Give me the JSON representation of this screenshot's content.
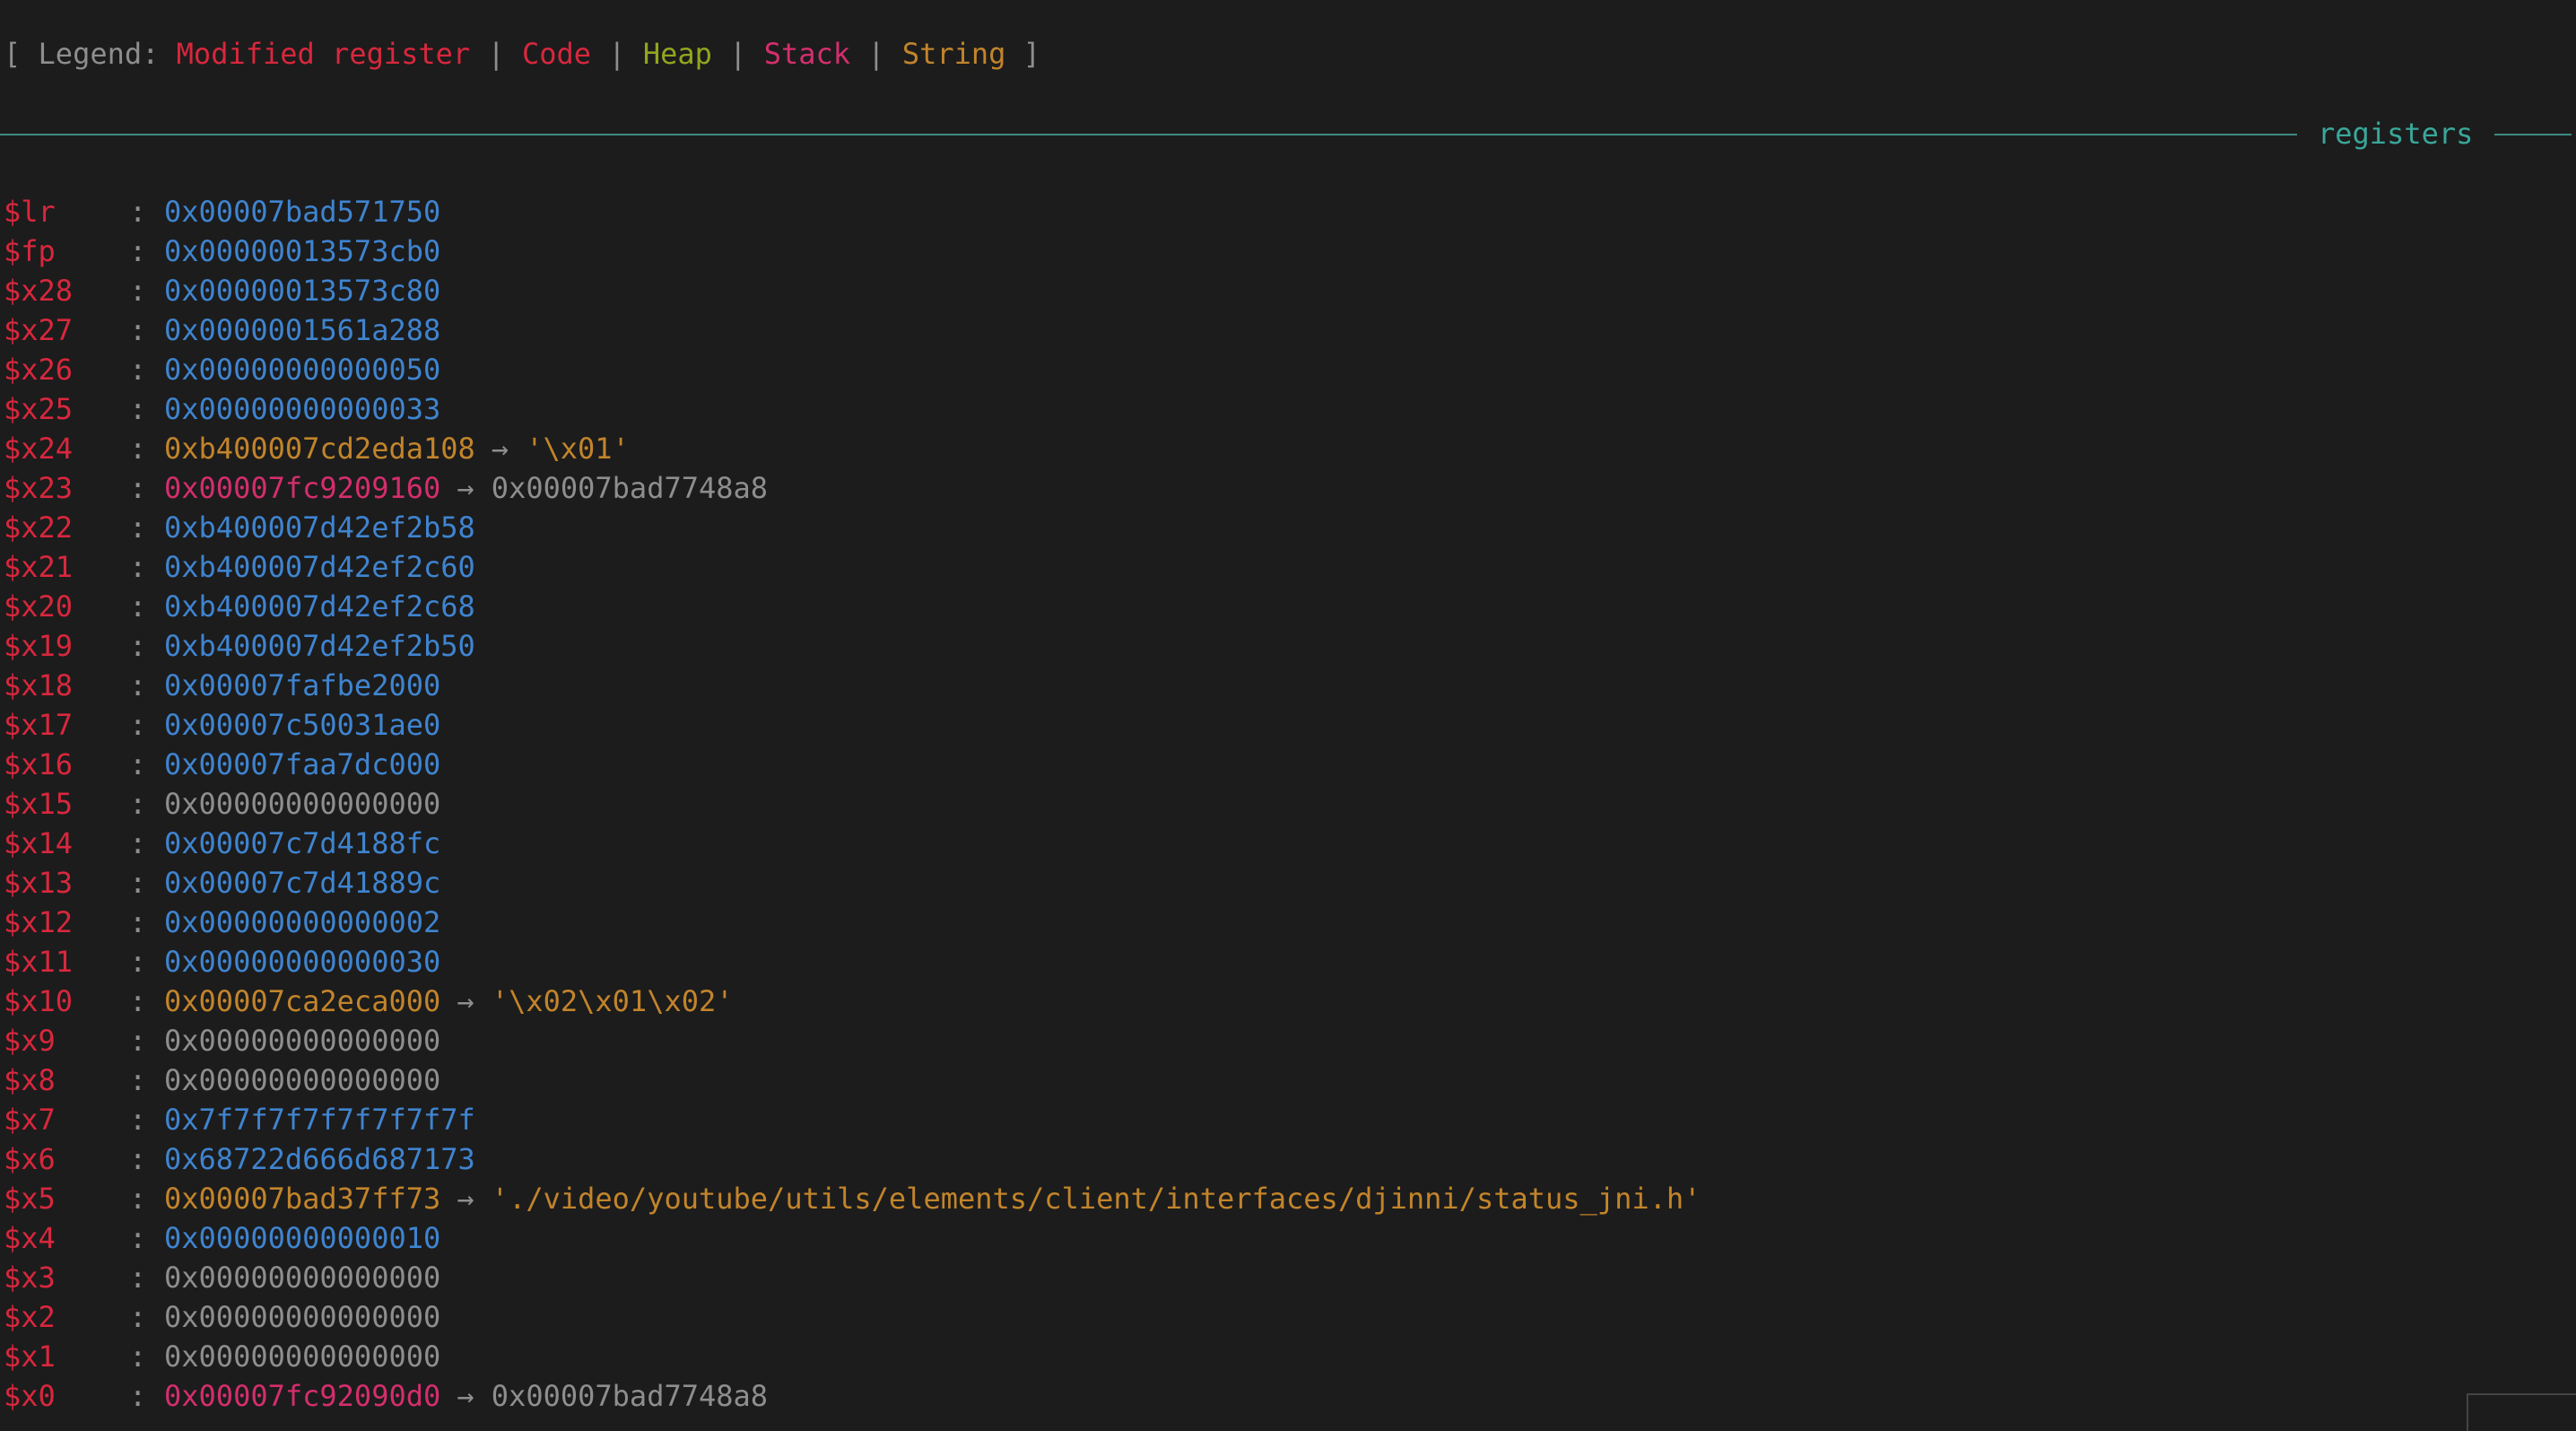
{
  "legend": {
    "open": "[ Legend: ",
    "modified": "Modified register",
    "sep1": " | ",
    "code": "Code",
    "sep2": " | ",
    "heap": "Heap",
    "sep3": " | ",
    "stack": "Stack",
    "sep4": " | ",
    "string": "String",
    "close": " ]"
  },
  "section": {
    "title": "registers"
  },
  "colors": {
    "modified": "#d8273d",
    "code": "#d8273d",
    "heap": "#93a51f",
    "stack": "#d42e6d",
    "string": "#c2842b",
    "pointer": "#3f84d0",
    "plain": "#8e8e8e",
    "accent": "#3aa79a"
  },
  "colon": ":",
  "arrow": "→",
  "registers": [
    {
      "name": "$lr",
      "value": "0x00007bad571750",
      "kind": "pointer"
    },
    {
      "name": "$fp",
      "value": "0x00000013573cb0",
      "kind": "pointer"
    },
    {
      "name": "$x28",
      "value": "0x00000013573c80",
      "kind": "pointer"
    },
    {
      "name": "$x27",
      "value": "0x0000001561a288",
      "kind": "pointer"
    },
    {
      "name": "$x26",
      "value": "0x00000000000050",
      "kind": "pointer"
    },
    {
      "name": "$x25",
      "value": "0x00000000000033",
      "kind": "pointer"
    },
    {
      "name": "$x24",
      "value": "0xb400007cd2eda108",
      "kind": "string",
      "deref": "'\\x01'",
      "deref_kind": "string"
    },
    {
      "name": "$x23",
      "value": "0x00007fc9209160",
      "kind": "stack",
      "deref": "0x00007bad7748a8",
      "deref_kind": "plain"
    },
    {
      "name": "$x22",
      "value": "0xb400007d42ef2b58",
      "kind": "pointer"
    },
    {
      "name": "$x21",
      "value": "0xb400007d42ef2c60",
      "kind": "pointer"
    },
    {
      "name": "$x20",
      "value": "0xb400007d42ef2c68",
      "kind": "pointer"
    },
    {
      "name": "$x19",
      "value": "0xb400007d42ef2b50",
      "kind": "pointer"
    },
    {
      "name": "$x18",
      "value": "0x00007fafbe2000",
      "kind": "pointer"
    },
    {
      "name": "$x17",
      "value": "0x00007c50031ae0",
      "kind": "pointer"
    },
    {
      "name": "$x16",
      "value": "0x00007faa7dc000",
      "kind": "pointer"
    },
    {
      "name": "$x15",
      "value": "0x00000000000000",
      "kind": "plain"
    },
    {
      "name": "$x14",
      "value": "0x00007c7d4188fc",
      "kind": "pointer"
    },
    {
      "name": "$x13",
      "value": "0x00007c7d41889c",
      "kind": "pointer"
    },
    {
      "name": "$x12",
      "value": "0x00000000000002",
      "kind": "pointer"
    },
    {
      "name": "$x11",
      "value": "0x00000000000030",
      "kind": "pointer"
    },
    {
      "name": "$x10",
      "value": "0x00007ca2eca000",
      "kind": "string",
      "deref": "'\\x02\\x01\\x02'",
      "deref_kind": "string"
    },
    {
      "name": "$x9",
      "value": "0x00000000000000",
      "kind": "plain"
    },
    {
      "name": "$x8",
      "value": "0x00000000000000",
      "kind": "plain"
    },
    {
      "name": "$x7",
      "value": "0x7f7f7f7f7f7f7f7f",
      "kind": "pointer"
    },
    {
      "name": "$x6",
      "value": "0x68722d666d687173",
      "kind": "pointer"
    },
    {
      "name": "$x5",
      "value": "0x00007bad37ff73",
      "kind": "string",
      "deref": "'./video/youtube/utils/elements/client/interfaces/djinni/status_jni.h'",
      "deref_kind": "string"
    },
    {
      "name": "$x4",
      "value": "0x00000000000010",
      "kind": "pointer"
    },
    {
      "name": "$x3",
      "value": "0x00000000000000",
      "kind": "plain"
    },
    {
      "name": "$x2",
      "value": "0x00000000000000",
      "kind": "plain"
    },
    {
      "name": "$x1",
      "value": "0x00000000000000",
      "kind": "plain"
    },
    {
      "name": "$x0",
      "value": "0x00007fc92090d0",
      "kind": "stack",
      "deref": "0x00007bad7748a8",
      "deref_kind": "plain"
    }
  ]
}
